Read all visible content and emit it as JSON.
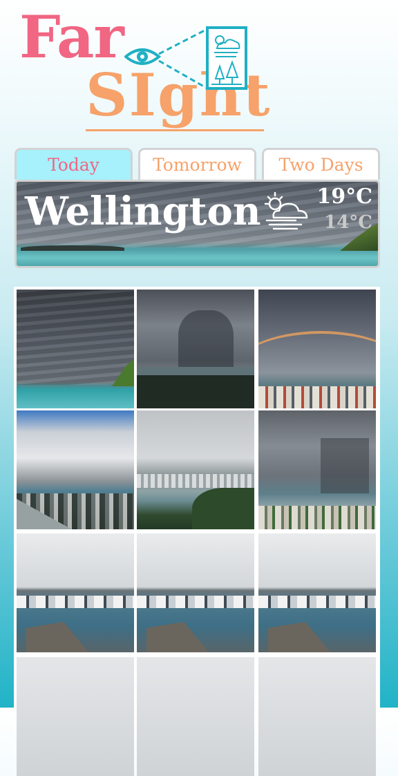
{
  "logo": {
    "line1": "Far",
    "line2": "SIght",
    "eye_icon": "eye-icon",
    "frame_icon": "weather-forest-icon"
  },
  "tabs": [
    {
      "label": "Today",
      "active": true
    },
    {
      "label": "Tomorrow",
      "active": false
    },
    {
      "label": "Two Days",
      "active": false
    }
  ],
  "weather": {
    "city": "Wellington",
    "icon": "fog-partly-cloudy-icon",
    "high": "19°C",
    "low": "14°C"
  },
  "gallery": {
    "photos": [
      {
        "scene": "stormy-clouds-over-sea"
      },
      {
        "scene": "dark-storm-over-harbour"
      },
      {
        "scene": "rainbow-over-city"
      },
      {
        "scene": "cumulus-over-bay"
      },
      {
        "scene": "overcast-harbour-view"
      },
      {
        "scene": "rain-cloud-over-city"
      },
      {
        "scene": "overcast-wharf"
      },
      {
        "scene": "overcast-wharf"
      },
      {
        "scene": "overcast-wharf"
      },
      {
        "scene": "overcast-sky"
      },
      {
        "scene": "overcast-sky"
      },
      {
        "scene": "overcast-sky"
      }
    ]
  },
  "colors": {
    "pink": "#f06683",
    "orange": "#f6a26a",
    "teal": "#21b3c7",
    "active_tab": "#a6f1fb"
  }
}
